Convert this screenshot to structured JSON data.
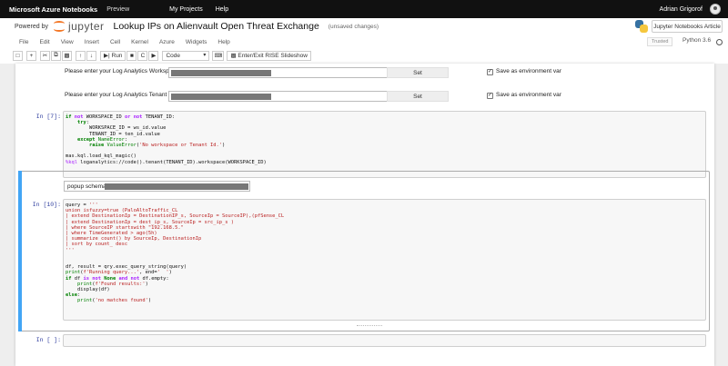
{
  "azure_bar": {
    "brand": "Microsoft Azure Notebooks",
    "preview": "Preview",
    "nav": [
      "My Projects",
      "Help"
    ],
    "user": "Adrian Grigorof"
  },
  "header": {
    "powered_by": "Powered by",
    "jupyter": "jupyter",
    "notebook_title": "Lookup IPs on Alienvault Open Threat Exchange",
    "status": "(unsaved changes)",
    "article_button": "Jupyter Notebooks Article"
  },
  "menubar": {
    "items": [
      "File",
      "Edit",
      "View",
      "Insert",
      "Cell",
      "Kernel",
      "Azure",
      "Widgets",
      "Help"
    ],
    "trusted": "Trusted",
    "kernel": "Python 3.6"
  },
  "toolbar": {
    "run_label": "Run",
    "cell_type": "Code",
    "slideshow_label": "Enter/Exit RISE Slideshow"
  },
  "form": {
    "workspace_label": "Please enter your Log Analytics Workspace Id:",
    "tenant_label": "Please enter your Log Analytics Tenant Id:",
    "set_label": "Set",
    "env_label": "Save as environment var"
  },
  "cells": {
    "cell7_prompt": "In [7]:",
    "popup_label": "popup schema",
    "cell10_prompt": "In [10]:",
    "empty_prompt": "In [ ]:"
  },
  "colors": {
    "azure_bar": "#111111",
    "selected_cell_accent": "#42a5f5",
    "jupyter_orange": "#f37726"
  }
}
